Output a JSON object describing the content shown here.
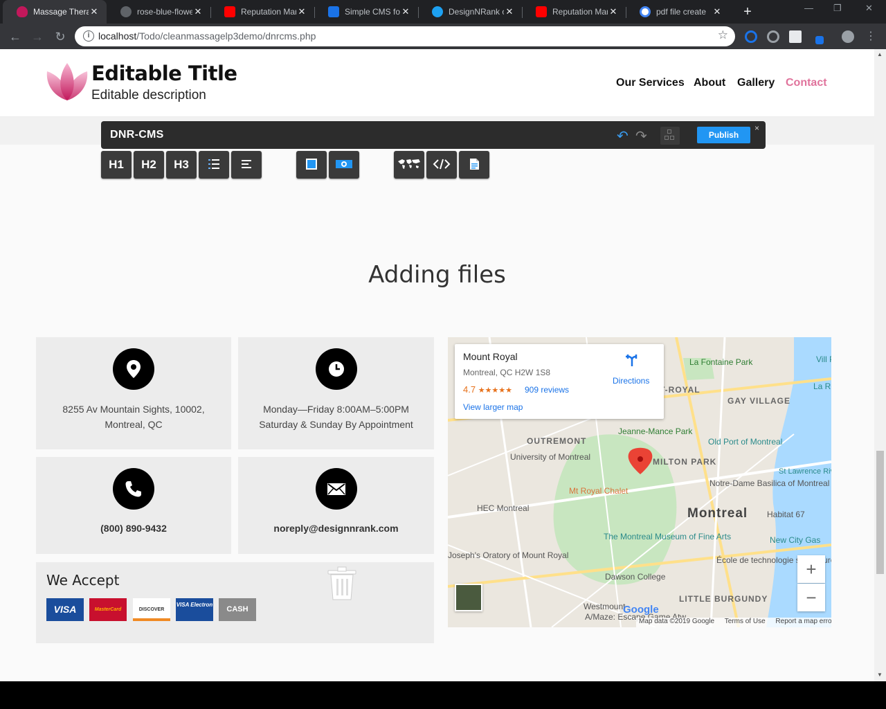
{
  "browser": {
    "tabs": [
      {
        "title": "Massage Therap",
        "active": true,
        "favicon_color": "#c2185b"
      },
      {
        "title": "rose-blue-flowe",
        "active": false,
        "favicon_color": "#5f6368"
      },
      {
        "title": "Reputation Man",
        "active": false,
        "favicon_color": "#ff0000"
      },
      {
        "title": "Simple CMS for",
        "active": false,
        "favicon_color": "#1a73e8"
      },
      {
        "title": "DesignNRank o",
        "active": false,
        "favicon_color": "#1da1f2"
      },
      {
        "title": "Reputation Man",
        "active": false,
        "favicon_color": "#ff0000"
      },
      {
        "title": "pdf file create",
        "active": false,
        "favicon_color": "#4285f4"
      }
    ],
    "url_host": "localhost",
    "url_path": "/Todo/cleanmassagelp3demo/dnrcms.php"
  },
  "site": {
    "title": "Editable Title",
    "description": "Editable description",
    "nav": [
      "Our Services",
      "About",
      "Gallery",
      "Contact"
    ],
    "nav_active": "Contact",
    "accent_color": "#e0739c"
  },
  "cms": {
    "name": "DNR-CMS",
    "publish_label": "Publish",
    "close_label": "×",
    "tools": [
      "H1",
      "H2",
      "H3",
      "list-icon",
      "paragraph-icon",
      "image-icon",
      "video-icon",
      "map-icon",
      "code-icon",
      "file-icon"
    ]
  },
  "section": {
    "heading": "Adding files"
  },
  "contact": {
    "address_line1": "8255 Av Mountain Sights, 10002,",
    "address_line2": "Montreal, QC",
    "hours_line1": "Monday—Friday 8:00AM–5:00PM",
    "hours_line2": "Saturday & Sunday By Appointment",
    "phone": "(800) 890-9432",
    "email": "noreply@designnrank.com"
  },
  "payments": {
    "title": "We Accept",
    "methods": [
      {
        "label": "VISA",
        "bg": "#1a4d9c",
        "fg": "#ffffff"
      },
      {
        "label": "MasterCard",
        "bg": "#c8102e",
        "fg": "#ffb000"
      },
      {
        "label": "DISCOVER",
        "bg": "#ffffff",
        "fg": "#333333"
      },
      {
        "label": "VISA Electron",
        "bg": "#1a4d9c",
        "fg": "#ffffff"
      },
      {
        "label": "CASH",
        "bg": "#8a8a8a",
        "fg": "#ffffff"
      }
    ]
  },
  "map": {
    "place_name": "Mount Royal",
    "place_address": "Montreal, QC H2W 1S8",
    "rating": "4.7",
    "stars": "★★★★★",
    "reviews": "909 reviews",
    "view_larger": "View larger map",
    "directions": "Directions",
    "labels": [
      "La Fontaine Park",
      "Vill Pie",
      "La Ron",
      "T-ROYAL",
      "GAY VILLAGE",
      "OUTREMONT",
      "Jeanne-Mance Park",
      "Old Port of Montreal",
      "St Lawrence River",
      "University of Montreal",
      "MILTON PARK",
      "Mt Royal Chalet",
      "Notre-Dame Basilica of Montreal",
      "HEC Montreal",
      "Montreal",
      "Habitat 67",
      "The Montreal Museum of Fine Arts",
      "New City Gas",
      "Joseph's Oratory of Mount Royal",
      "École de technologie supérieure ETS",
      "Dawson College",
      "LITTLE BURGUNDY",
      "Westmount",
      "A/Maze: Escape Game Atw"
    ],
    "attribution": [
      "Map data ©2019 Google",
      "Terms of Use",
      "Report a map error"
    ],
    "zoom_in": "+",
    "zoom_out": "−",
    "google": "Google"
  }
}
